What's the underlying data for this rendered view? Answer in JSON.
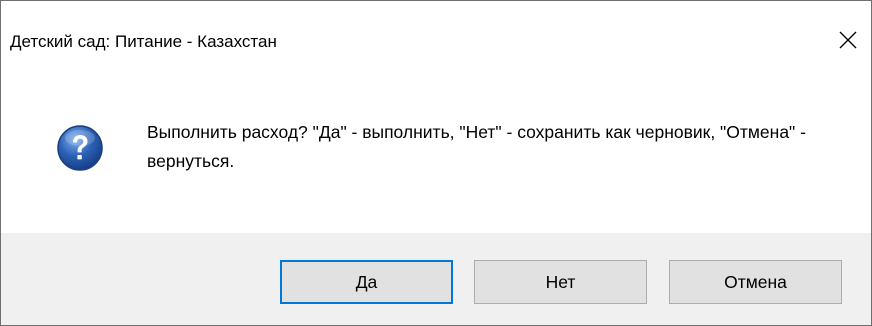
{
  "window": {
    "title": "Детский сад: Питание - Казахстан"
  },
  "message": {
    "text": "Выполнить расход? \"Да\" - выполнить, \"Нет\" - сохранить как черновик, \"Отмена\" - вернуться.",
    "icon": "question-icon"
  },
  "buttons": {
    "yes_label": "Да",
    "no_label": "Нет",
    "cancel_label": "Отмена"
  },
  "colors": {
    "footer_background": "#f0f0f0",
    "button_face": "#e1e1e1",
    "default_button_border": "#0078d7",
    "icon_blue": "#2d61b5"
  }
}
